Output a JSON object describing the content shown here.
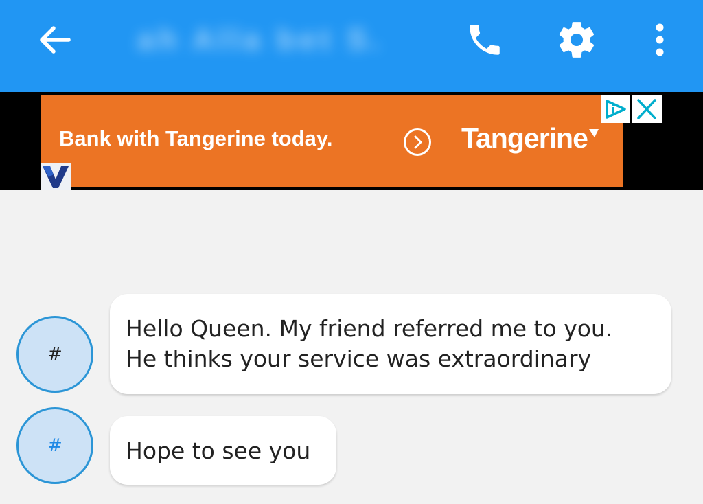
{
  "app_bar": {
    "title": "ah Alla bet S.",
    "color": "#2196f3"
  },
  "ad": {
    "headline": "Bank with Tangerine today.",
    "brand": "Tangerine",
    "banner_color": "#ec7424",
    "adchoices_color": "#00aecd",
    "icons": [
      "arrow-circle-icon",
      "adchoices-icon",
      "close-icon",
      "advertiser-logo-icon"
    ]
  },
  "messages": [
    {
      "avatar_initial": "#",
      "avatar_text_color": "#222222",
      "lines": [
        "Hello Queen. My friend referred me to you.",
        "He thinks your service was extraordinary"
      ]
    },
    {
      "avatar_initial": "#",
      "avatar_text_color": "#1e88e5",
      "lines": [
        "Hope to see you"
      ]
    }
  ],
  "icons": {
    "back": "arrow-left-icon",
    "call": "phone-icon",
    "settings": "gear-icon",
    "more": "more-vertical-icon"
  }
}
